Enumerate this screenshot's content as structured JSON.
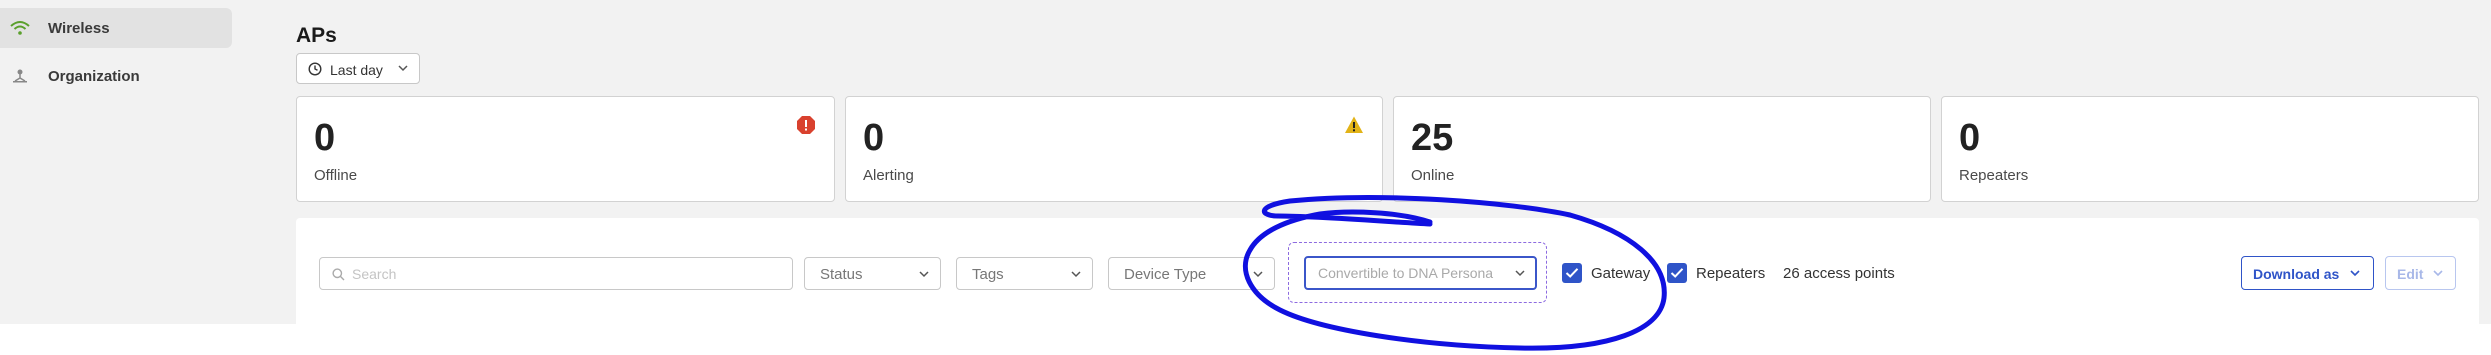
{
  "sidebar": {
    "items": [
      {
        "label": "Wireless",
        "icon": "wifi-icon",
        "active": true
      },
      {
        "label": "Organization",
        "icon": "organization-icon",
        "active": false
      }
    ]
  },
  "header": {
    "title": "APs",
    "time_range": "Last day"
  },
  "stats": [
    {
      "value": "0",
      "label": "Offline",
      "badge": "error-icon"
    },
    {
      "value": "0",
      "label": "Alerting",
      "badge": "warning-icon"
    },
    {
      "value": "25",
      "label": "Online"
    },
    {
      "value": "0",
      "label": "Repeaters"
    }
  ],
  "filters": {
    "search_placeholder": "Search",
    "status": "Status",
    "tags": "Tags",
    "device_type": "Device Type",
    "dna_persona": "Convertible to DNA Persona",
    "gateway_label": "Gateway",
    "gateway_checked": true,
    "repeaters_label": "Repeaters",
    "repeaters_checked": true,
    "count": "26 access points"
  },
  "actions": {
    "download": "Download as",
    "edit": "Edit"
  },
  "colors": {
    "accent": "#2f54c8",
    "error": "#d9412e",
    "warning": "#e2b317",
    "wifi": "#5aa02c",
    "annotation": "#1010e0"
  }
}
